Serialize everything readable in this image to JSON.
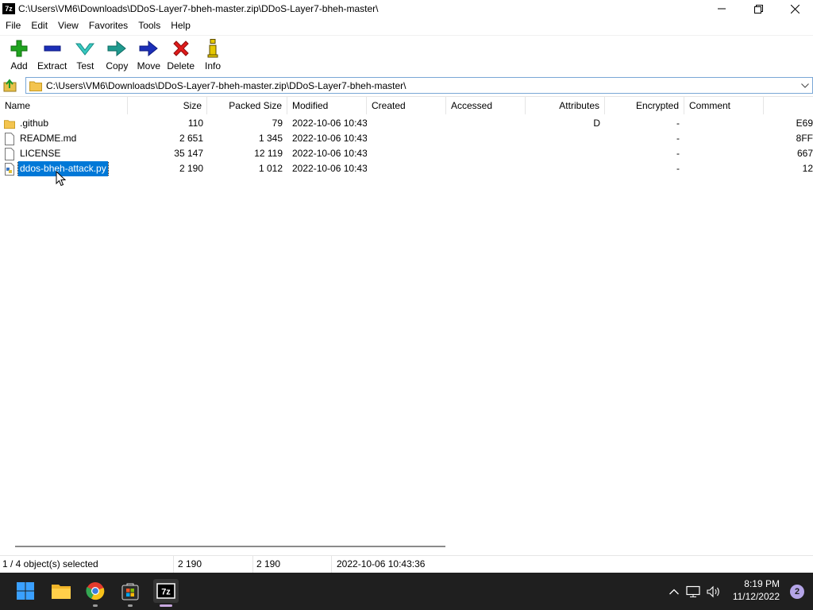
{
  "window": {
    "app_icon_text": "7z",
    "title": "C:\\Users\\VM6\\Downloads\\DDoS-Layer7-bheh-master.zip\\DDoS-Layer7-bheh-master\\"
  },
  "menu": [
    "File",
    "Edit",
    "View",
    "Favorites",
    "Tools",
    "Help"
  ],
  "toolbar": {
    "add": "Add",
    "extract": "Extract",
    "test": "Test",
    "copy": "Copy",
    "move": "Move",
    "delete": "Delete",
    "info": "Info"
  },
  "address": {
    "path": "C:\\Users\\VM6\\Downloads\\DDoS-Layer7-bheh-master.zip\\DDoS-Layer7-bheh-master\\"
  },
  "columns": {
    "name": "Name",
    "size": "Size",
    "packed": "Packed Size",
    "modified": "Modified",
    "created": "Created",
    "accessed": "Accessed",
    "attributes": "Attributes",
    "encrypted": "Encrypted",
    "comment": "Comment"
  },
  "files": [
    {
      "name": ".github",
      "size": "110",
      "packed": "79",
      "modified": "2022-10-06 10:43",
      "attributes": "D",
      "encrypted": "-",
      "crc": "E69",
      "icon": "folder-icon"
    },
    {
      "name": "README.md",
      "size": "2 651",
      "packed": "1 345",
      "modified": "2022-10-06 10:43",
      "attributes": "",
      "encrypted": "-",
      "crc": "8FF",
      "icon": "document-icon"
    },
    {
      "name": "LICENSE",
      "size": "35 147",
      "packed": "12 119",
      "modified": "2022-10-06 10:43",
      "attributes": "",
      "encrypted": "-",
      "crc": "667",
      "icon": "document-icon"
    },
    {
      "name": "ddos-bheh-attack.py",
      "size": "2 190",
      "packed": "1 012",
      "modified": "2022-10-06 10:43",
      "attributes": "",
      "encrypted": "-",
      "crc": "12",
      "icon": "python-file-icon",
      "selected": true
    }
  ],
  "status": {
    "selection": "1 / 4 object(s) selected",
    "size": "2 190",
    "packed": "2 190",
    "modified": "2022-10-06 10:43:36"
  },
  "taskbar": {
    "time": "8:19 PM",
    "date": "11/12/2022",
    "notifications": "2"
  },
  "colors": {
    "selection": "#0078d7",
    "taskbar": "#1f1f1f",
    "address_border": "#7aa7d6"
  }
}
